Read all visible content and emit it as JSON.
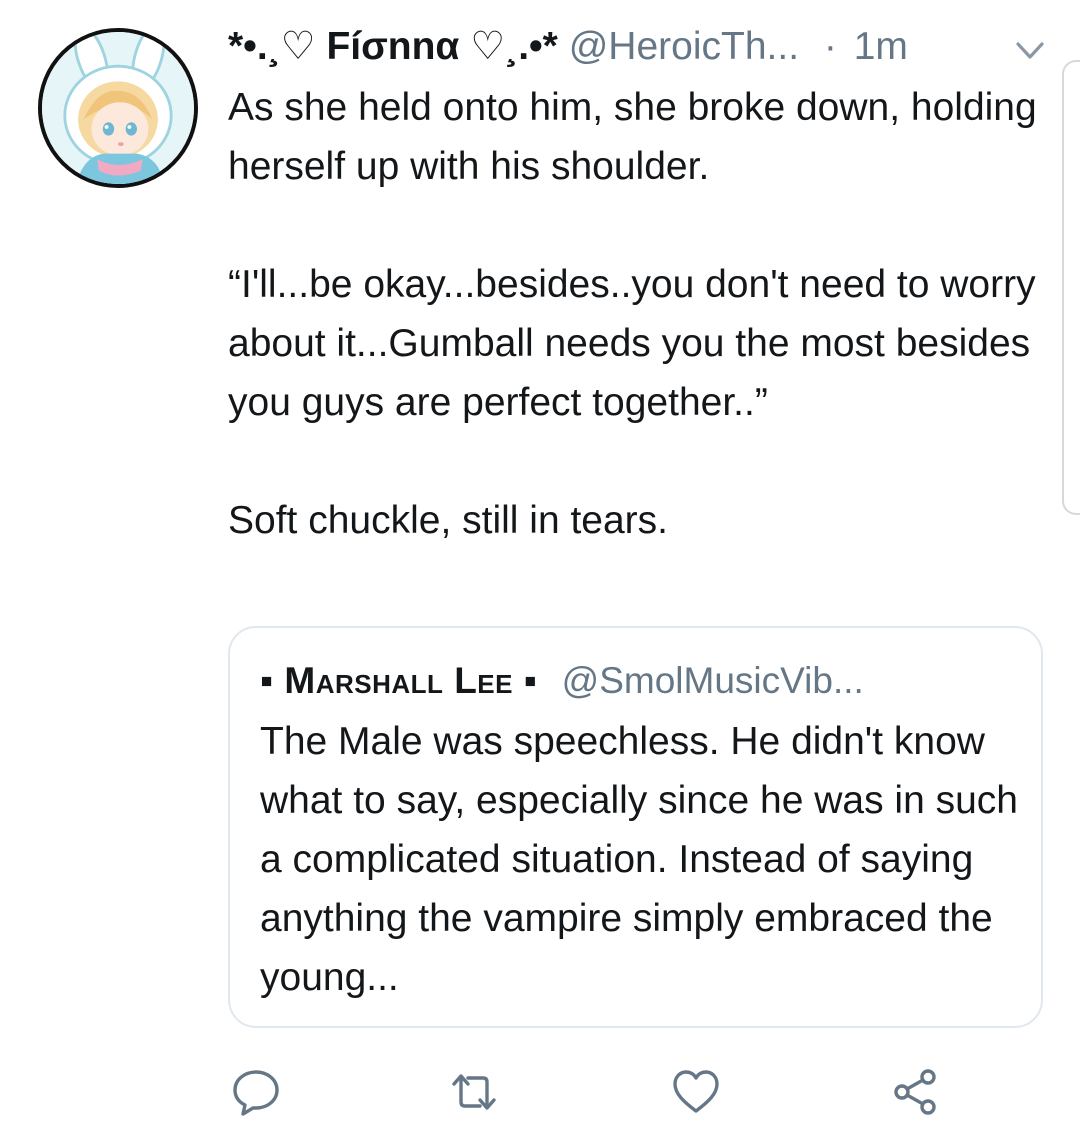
{
  "tweet": {
    "display_name": "*•.¸♡ Fíσnnα ♡¸.•*",
    "handle": "@HeroicTh...",
    "separator": "·",
    "time": "1m",
    "text": "As she held onto him, she broke down, holding herself up with his shoulder.\n\n“I'll...be okay...besides..you don't need to worry about it...Gumball needs you the most besides you guys are perfect together..”\n\nSoft chuckle, still in tears."
  },
  "quoted_tweet": {
    "display_name": "▪ Marshall Lee ▪",
    "handle": "@SmolMusicVib...",
    "text": "The Male was speechless. He didn't know what to say, especially since he was in such a complicated situation. Instead of saying anything the vampire simply embraced the young..."
  },
  "icons": {
    "menu": "chevron-down-icon",
    "reply": "reply-icon",
    "retweet": "retweet-icon",
    "like": "heart-icon",
    "share": "share-icon"
  },
  "colors": {
    "text": "#14171a",
    "secondary_text": "#657786",
    "border": "#e1e8ed",
    "icon": "#657786"
  }
}
